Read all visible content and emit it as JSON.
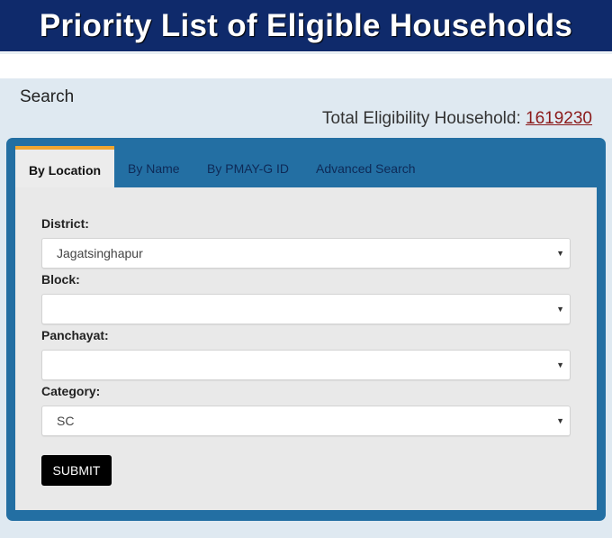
{
  "header": {
    "title": "Priority List of Eligible Households"
  },
  "search": {
    "heading": "Search",
    "total_label": "Total Eligibility Household:",
    "total_value": "1619230"
  },
  "tabs": [
    {
      "label": "By Location",
      "active": true
    },
    {
      "label": "By Name",
      "active": false
    },
    {
      "label": "By PMAY-G ID",
      "active": false
    },
    {
      "label": "Advanced Search",
      "active": false
    }
  ],
  "form": {
    "district": {
      "label": "District:",
      "value": "Jagatsinghapur"
    },
    "block": {
      "label": "Block:",
      "value": ""
    },
    "panchayat": {
      "label": "Panchayat:",
      "value": ""
    },
    "category": {
      "label": "Category:",
      "value": "SC"
    },
    "submit_label": "SUBMIT",
    "dropdown_arrow": "▼"
  },
  "colors": {
    "banner": "#0f2a6b",
    "panel": "#236fa3",
    "active_tab_accent": "#f0a530",
    "total_link": "#8b1a1a"
  }
}
